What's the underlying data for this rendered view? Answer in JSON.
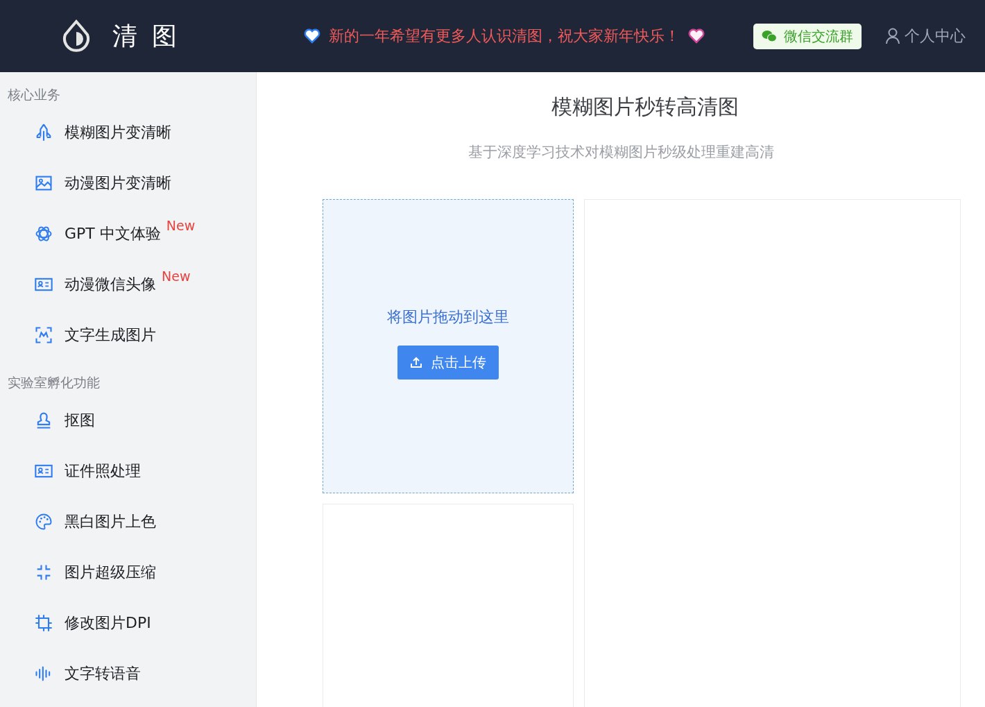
{
  "header": {
    "logo_text": "清 图",
    "announcement": "新的一年希望有更多人认识清图，祝大家新年快乐！",
    "wechat_button": "微信交流群",
    "account_link": "个人中心"
  },
  "sidebar": {
    "sections": [
      {
        "title": "核心业务",
        "items": [
          {
            "label": "模糊图片变清晰",
            "kind": "rocket"
          },
          {
            "label": "动漫图片变清晰",
            "kind": "image"
          },
          {
            "label": "GPT 中文体验",
            "kind": "gpt",
            "badge": "New"
          },
          {
            "label": "动漫微信头像",
            "kind": "card",
            "badge": "New"
          },
          {
            "label": "文字生成图片",
            "kind": "scan"
          }
        ]
      },
      {
        "title": "实验室孵化功能",
        "items": [
          {
            "label": "抠图",
            "kind": "stamp"
          },
          {
            "label": "证件照处理",
            "kind": "card"
          },
          {
            "label": "黑白图片上色",
            "kind": "palette"
          },
          {
            "label": "图片超级压缩",
            "kind": "compress"
          },
          {
            "label": "修改图片DPI",
            "kind": "crop"
          },
          {
            "label": "文字转语音",
            "kind": "wave"
          }
        ]
      }
    ]
  },
  "main": {
    "title": "模糊图片秒转高清图",
    "subtitle": "基于深度学习技术对模糊图片秒级处理重建高清",
    "upload": {
      "hint": "将图片拖动到这里",
      "button": "点击上传"
    }
  }
}
